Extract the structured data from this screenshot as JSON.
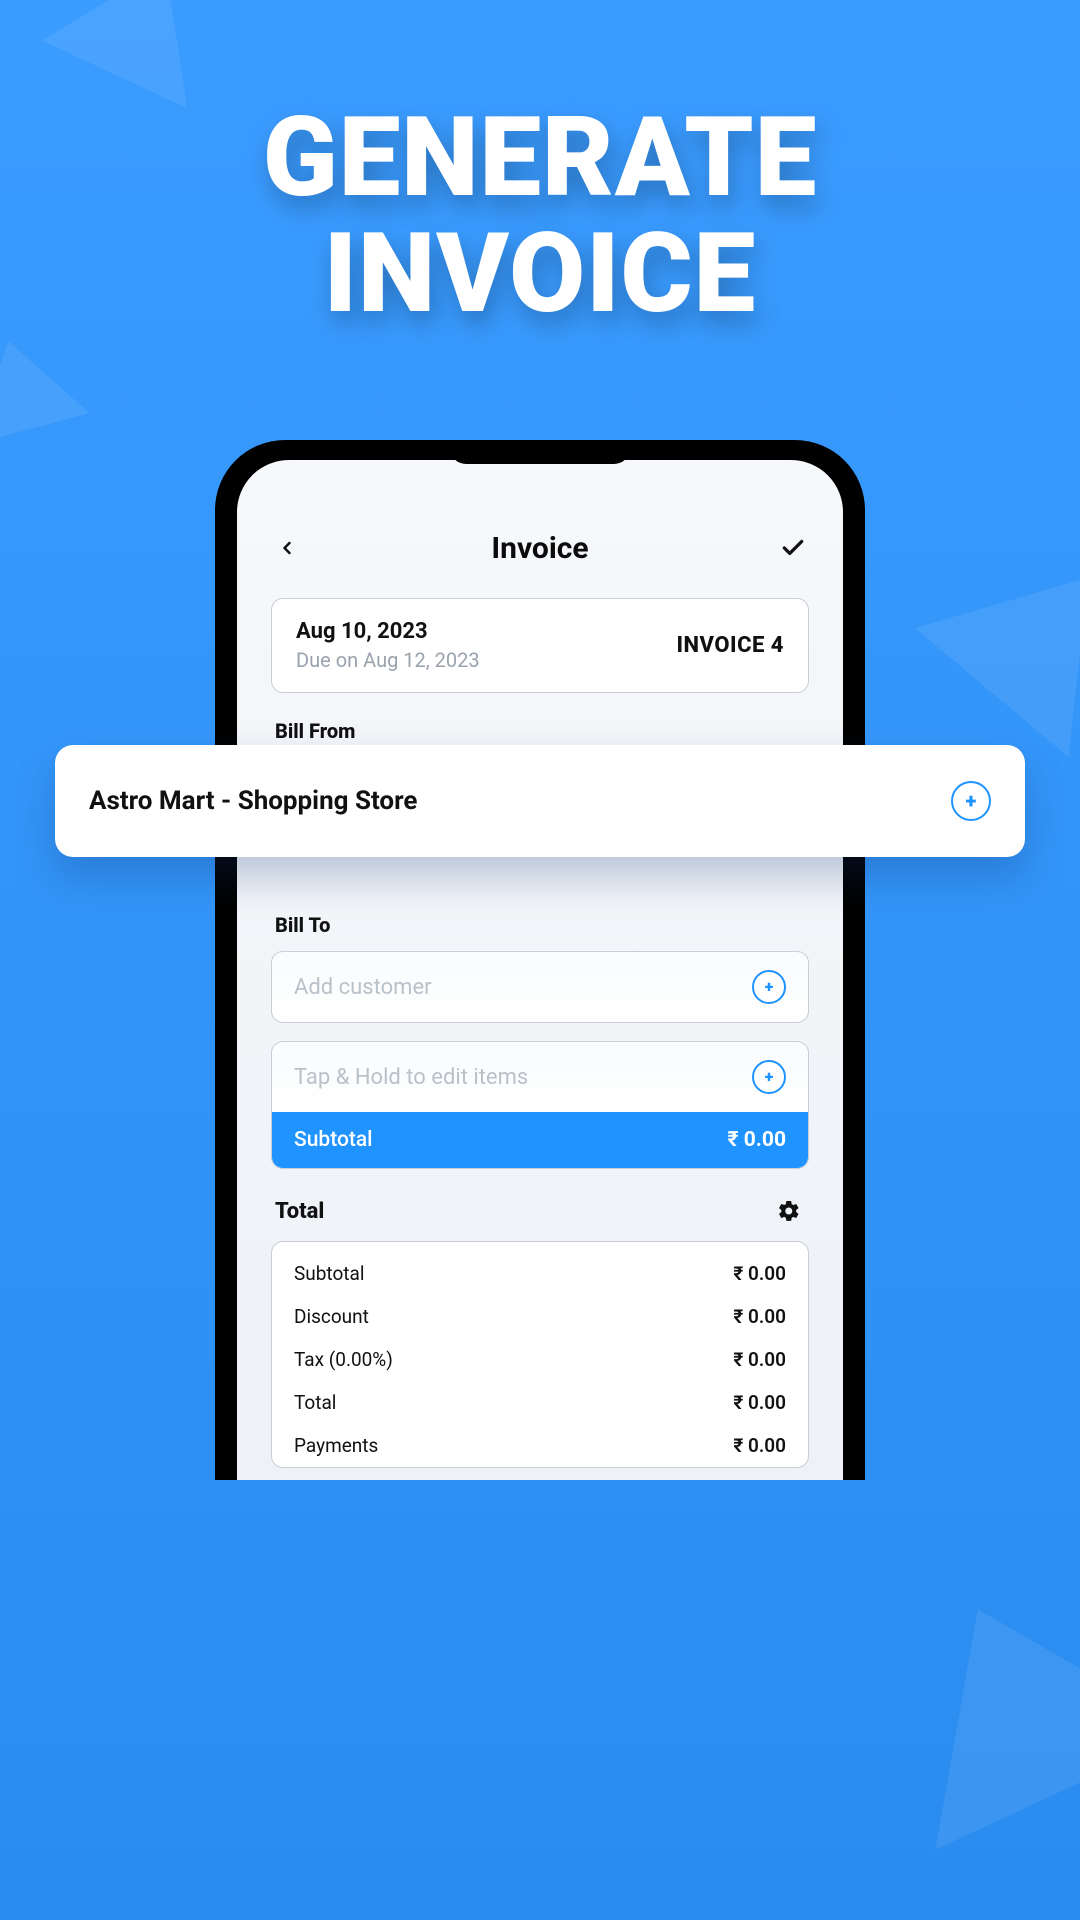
{
  "hero": {
    "line1": "GENERATE",
    "line2": "INVOICE"
  },
  "appbar": {
    "title": "Invoice"
  },
  "meta": {
    "date": "Aug 10, 2023",
    "due": "Due on Aug 12, 2023",
    "invoice_number": "INVOICE 4"
  },
  "sections": {
    "bill_from": "Bill From",
    "bill_to": "Bill To",
    "total": "Total"
  },
  "bill_from_name": "Astro Mart - Shopping Store",
  "placeholders": {
    "add_customer": "Add customer",
    "edit_items": "Tap & Hold to edit items"
  },
  "subtotal_bar": {
    "label": "Subtotal",
    "amount": "₹ 0.00"
  },
  "totals": [
    {
      "label": "Subtotal",
      "value": "₹ 0.00"
    },
    {
      "label": "Discount",
      "value": "₹ 0.00"
    },
    {
      "label": "Tax (0.00%)",
      "value": "₹ 0.00"
    },
    {
      "label": "Total",
      "value": "₹ 0.00"
    },
    {
      "label": "Payments",
      "value": "₹ 0.00"
    }
  ]
}
